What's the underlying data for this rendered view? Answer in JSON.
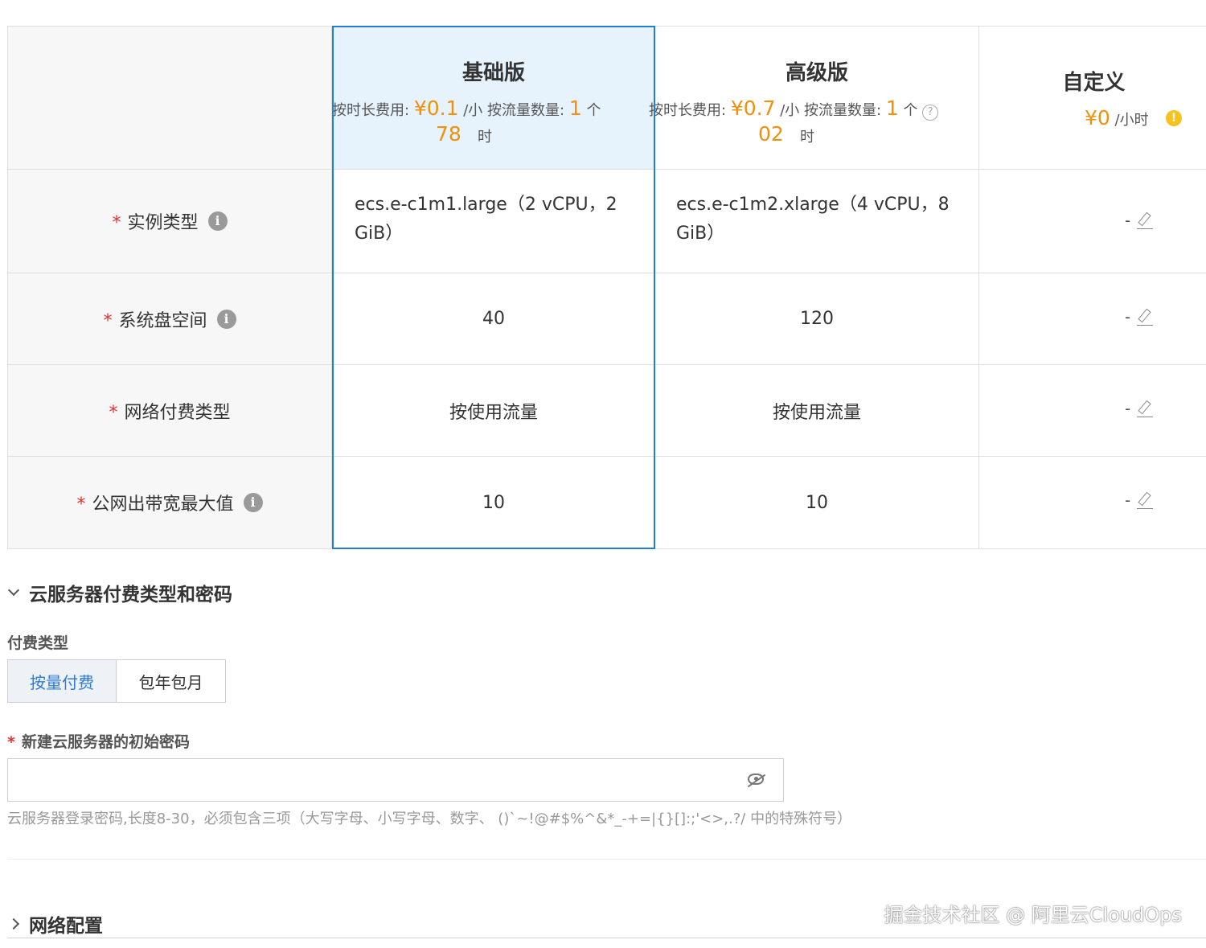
{
  "plans": {
    "basic": {
      "title": "基础版",
      "price_label": "按时长费用:",
      "price_value_1": "¥0.1",
      "price_value_2": "78",
      "price_unit_1": "/小",
      "price_unit_2": "时",
      "traffic_label": "按流量数量:",
      "traffic_value": "1",
      "traffic_unit": "个"
    },
    "advanced": {
      "title": "高级版",
      "price_label": "按时长费用:",
      "price_value_1": "¥0.7",
      "price_value_2": "02",
      "price_unit_1": "/小",
      "price_unit_2": "时",
      "traffic_label": "按流量数量:",
      "traffic_value": "1",
      "traffic_unit": "个"
    },
    "custom": {
      "title": "自定义",
      "price_value": "¥0",
      "price_unit": "/小时"
    }
  },
  "rows": [
    {
      "label": "实例类型",
      "required": "*",
      "has_info": true,
      "basic": "ecs.e-c1m1.large（2 vCPU，2 GiB）",
      "advanced": "ecs.e-c1m2.xlarge（4 vCPU，8 GiB）",
      "custom": "-"
    },
    {
      "label": "系统盘空间",
      "required": "*",
      "has_info": true,
      "basic": "40",
      "advanced": "120",
      "custom": "-"
    },
    {
      "label": "网络付费类型",
      "required": "*",
      "has_info": false,
      "basic": "按使用流量",
      "advanced": "按使用流量",
      "custom": "-"
    },
    {
      "label": "公网出带宽最大值",
      "required": "*",
      "has_info": true,
      "basic": "10",
      "advanced": "10",
      "custom": "-"
    }
  ],
  "section_billing": {
    "title": "云服务器付费类型和密码",
    "pay_type_label": "付费类型",
    "pay_options": [
      "按量付费",
      "包年包月"
    ],
    "password_label": "新建云服务器的初始密码",
    "password_required": "*",
    "password_value": "",
    "password_hint": "云服务器登录密码,长度8-30，必须包含三项（大写字母、小写字母、数字、 ()`~!@#$%^&*_-+=|{}[]:;'<>,.?/ 中的特殊符号）"
  },
  "section_network": {
    "title": "网络配置"
  },
  "watermark": "掘金技术社区 @ 阿里云CloudOps",
  "colors": {
    "accent": "#1f7fd4",
    "price": "#f0900b",
    "required": "#e0332f",
    "selected_header_bg": "#e6f3fd"
  }
}
